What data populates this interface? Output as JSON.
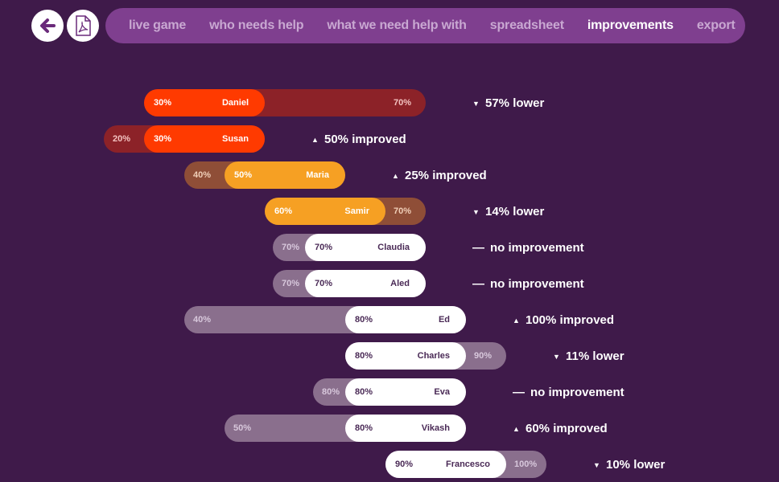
{
  "toolbar": {
    "back_icon": "arrow-left-icon",
    "pdf_icon": "pdf-icon"
  },
  "nav": {
    "items": [
      {
        "label": "live game",
        "active": false
      },
      {
        "label": "who needs help",
        "active": false
      },
      {
        "label": "what we need help with",
        "active": false
      },
      {
        "label": "spreadsheet",
        "active": false
      },
      {
        "label": "improvements",
        "active": true
      },
      {
        "label": "export",
        "active": false
      }
    ]
  },
  "colors": {
    "background": "#3f1a4a",
    "nav": "#7f3f8f",
    "red": {
      "pill": "#ff3a00",
      "back": "#8c2228",
      "text": "#ffffff",
      "old_text": "#f3c2c0"
    },
    "orange": {
      "pill": "#f6a023",
      "back": "#8f4e37",
      "text": "#ffffff",
      "old_text": "#f0cfb8"
    },
    "white": {
      "pill": "#ffffff",
      "back": "#8a6f8d",
      "text": "#4a2a56",
      "old_text": "#d8c8dc"
    }
  },
  "people": [
    {
      "name": "Daniel",
      "new": 30,
      "old": 70,
      "tier": "red",
      "trend": "down",
      "status": "57% lower"
    },
    {
      "name": "Susan",
      "new": 30,
      "old": 20,
      "tier": "red",
      "trend": "up",
      "status": "50% improved"
    },
    {
      "name": "Maria",
      "new": 50,
      "old": 40,
      "tier": "orange",
      "trend": "up",
      "status": "25% improved"
    },
    {
      "name": "Samir",
      "new": 60,
      "old": 70,
      "tier": "orange",
      "trend": "down",
      "status": "14% lower"
    },
    {
      "name": "Claudia",
      "new": 70,
      "old": 70,
      "tier": "white",
      "trend": "same",
      "status": "no improvement"
    },
    {
      "name": "Aled",
      "new": 70,
      "old": 70,
      "tier": "white",
      "trend": "same",
      "status": "no improvement"
    },
    {
      "name": "Ed",
      "new": 80,
      "old": 40,
      "tier": "white",
      "trend": "up",
      "status": "100% improved"
    },
    {
      "name": "Charles",
      "new": 80,
      "old": 90,
      "tier": "white",
      "trend": "down",
      "status": "11% lower"
    },
    {
      "name": "Eva",
      "new": 80,
      "old": 80,
      "tier": "white",
      "trend": "same",
      "status": "no improvement"
    },
    {
      "name": "Vikash",
      "new": 80,
      "old": 50,
      "tier": "white",
      "trend": "up",
      "status": "60% improved"
    },
    {
      "name": "Francesco",
      "new": 90,
      "old": 100,
      "tier": "white",
      "trend": "down",
      "status": "10% lower"
    }
  ]
}
